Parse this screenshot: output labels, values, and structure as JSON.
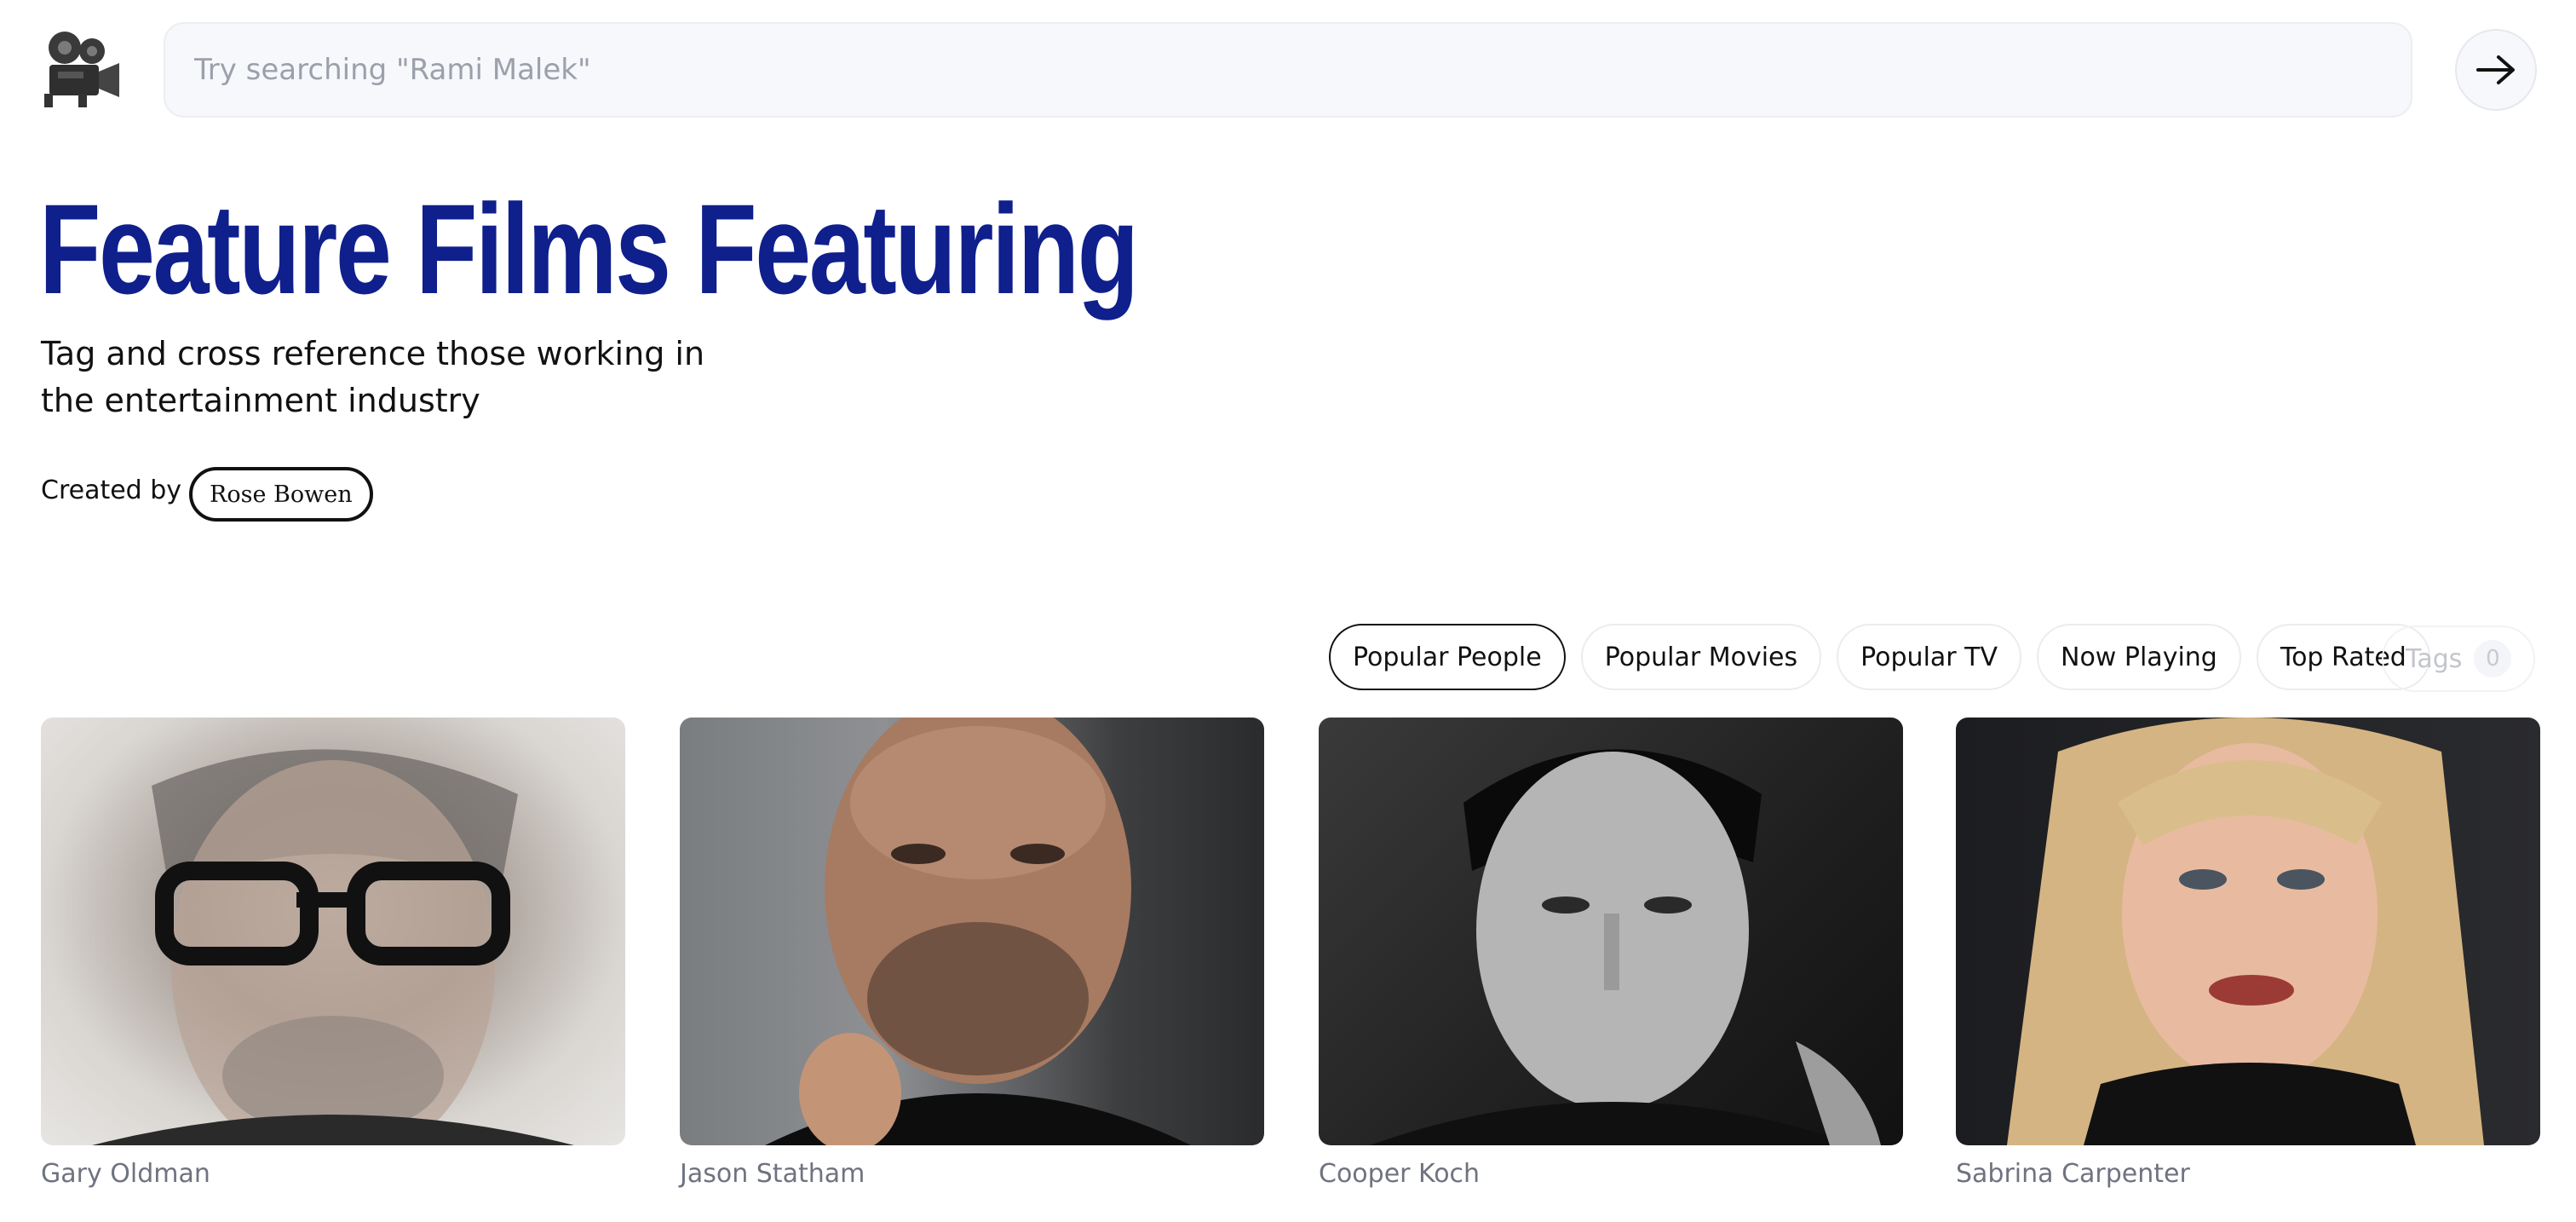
{
  "header": {
    "logo_icon": "movie-camera-icon",
    "search_placeholder": "Try searching \"Rami Malek\"",
    "go_icon": "arrow-right-icon"
  },
  "hero": {
    "title": "Feature Films Featuring",
    "subtitle": "Tag and cross reference those working in the entertainment industry",
    "created_by_label": "Created by",
    "creator": "Rose Bowen"
  },
  "tabs": [
    {
      "label": "Popular People",
      "active": true
    },
    {
      "label": "Popular Movies",
      "active": false
    },
    {
      "label": "Popular TV",
      "active": false
    },
    {
      "label": "Now Playing",
      "active": false
    },
    {
      "label": "Top Rated",
      "active": false
    }
  ],
  "tags": {
    "label": "Tags",
    "count": "0"
  },
  "people": [
    {
      "name": "Gary Oldman"
    },
    {
      "name": "Jason Statham"
    },
    {
      "name": "Cooper Koch"
    },
    {
      "name": "Sabrina Carpenter"
    }
  ],
  "colors": {
    "title": "#0f1f8c",
    "search_bg": "#f7f8fb",
    "muted_text": "#6f7380"
  }
}
